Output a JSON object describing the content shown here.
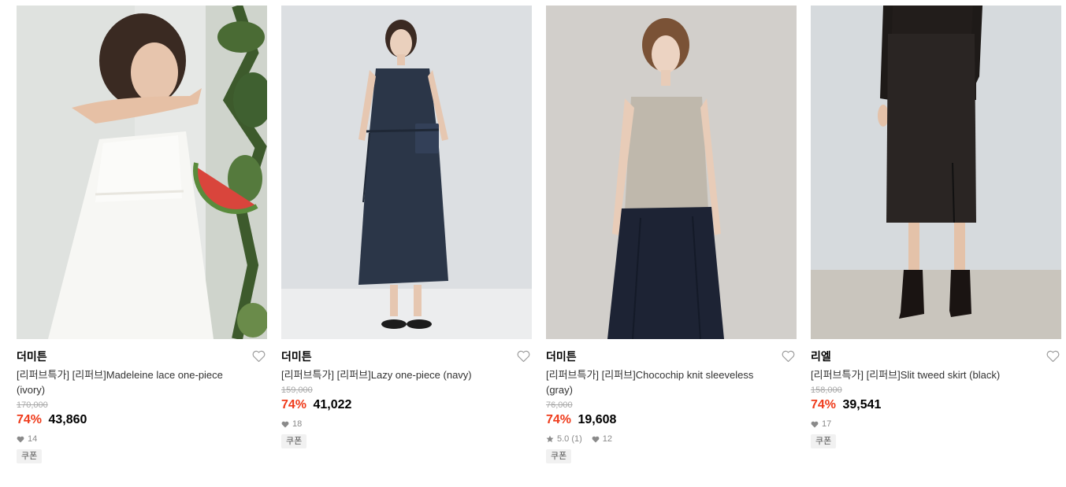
{
  "products": [
    {
      "brand": "더미튼",
      "title": "[리퍼브특가] [리퍼브]Madeleine lace one-piece (ivory)",
      "original_price": "170,000",
      "discount": "74%",
      "price": "43,860",
      "rating": "",
      "likes": "14",
      "coupon": "쿠폰",
      "photo": "woman in white lace dress holding watermelon"
    },
    {
      "brand": "더미튼",
      "title": "[리퍼브특가] [리퍼브]Lazy one-piece (navy)",
      "original_price": "159,000",
      "discount": "74%",
      "price": "41,022",
      "rating": "",
      "likes": "18",
      "coupon": "쿠폰",
      "photo": "woman in navy sleeveless one-piece"
    },
    {
      "brand": "더미튼",
      "title": "[리퍼브특가] [리퍼브]Chocochip knit sleeveless (gray)",
      "original_price": "76,000",
      "discount": "74%",
      "price": "19,608",
      "rating": "5.0 (1)",
      "likes": "12",
      "coupon": "쿠폰",
      "photo": "woman in gray knit sleeveless and navy skirt"
    },
    {
      "brand": "리엘",
      "title": "[리퍼브특가] [리퍼브]Slit tweed skirt (black)",
      "original_price": "158,000",
      "discount": "74%",
      "price": "39,541",
      "rating": "",
      "likes": "17",
      "coupon": "쿠폰",
      "photo": "black tweed skirt with ankle boots"
    }
  ],
  "colors": {
    "discount": "#ef3b1b",
    "muted": "#8a8a8a",
    "strike": "#a8a8a8"
  }
}
